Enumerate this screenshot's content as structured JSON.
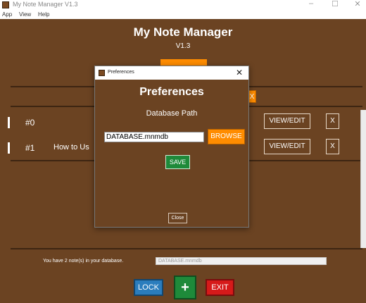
{
  "window": {
    "title": "My Note Manager V1.3",
    "controls": {
      "minimize": "–",
      "maximize": "☐",
      "close": "✕"
    }
  },
  "menu": [
    "App",
    "View",
    "Help"
  ],
  "app": {
    "title": "My Note Manager",
    "version": "V1.3",
    "header_delete_label": "X"
  },
  "notes": [
    {
      "number": "#0",
      "title": "",
      "view_label": "VIEW/EDIT",
      "delete_label": "X"
    },
    {
      "number": "#1",
      "title": "How to Us",
      "view_label": "VIEW/EDIT",
      "delete_label": "X"
    }
  ],
  "status": {
    "text": "You have 2 note(s) in your database.",
    "db_file": "DATABASE.mnmdb"
  },
  "bottom_buttons": {
    "lock": "LOCK",
    "add": "+",
    "exit": "EXIT"
  },
  "dialog": {
    "title": "Preferences",
    "close_glyph": "✕",
    "heading": "Preferences",
    "label": "Database Path",
    "path_value": "DATABASE.mnmdb",
    "browse_label": "BROWSE",
    "save_label": "SAVE",
    "close_label": "Close"
  },
  "colors": {
    "background": "#6b4322",
    "accent_orange": "#ff8c00",
    "save_green": "#1e8a3a",
    "lock_blue": "#2b7dbd",
    "exit_red": "#d61a1a"
  }
}
